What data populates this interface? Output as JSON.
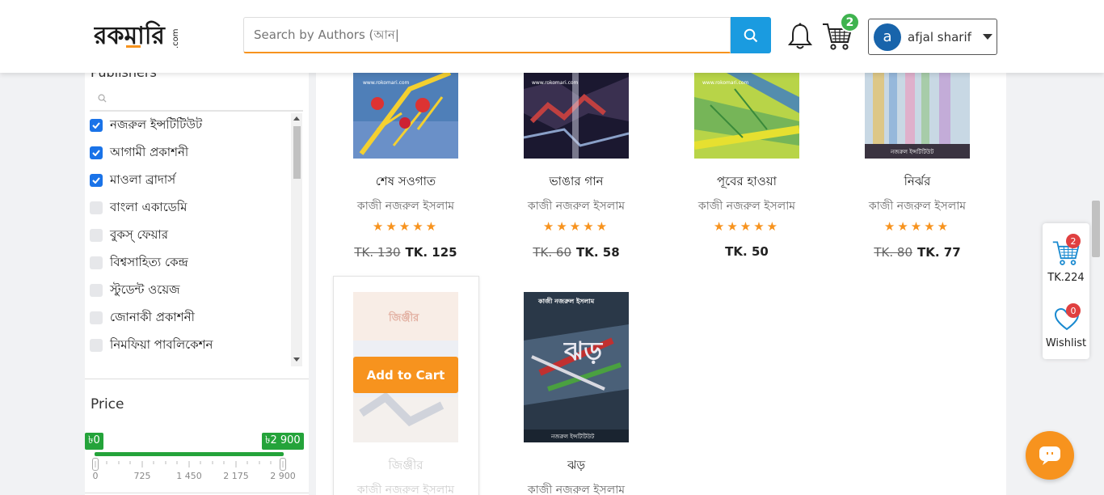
{
  "brand": {
    "logo_text": "রকমারি",
    "logo_suffix": ".com",
    "accent": "#f7931e",
    "primary": "#1a9be0"
  },
  "search": {
    "placeholder": "Search by Authors (আন|"
  },
  "header": {
    "cart_count": "2",
    "user_initial": "a",
    "user_name": "afjal sharif"
  },
  "sidebar": {
    "publishers_title": "Publishers",
    "publishers": [
      {
        "label": "নজরুল ইন্সটিটিউট",
        "checked": true
      },
      {
        "label": "আগামী প্রকাশনী",
        "checked": true
      },
      {
        "label": "মাওলা ব্রাদার্স",
        "checked": true
      },
      {
        "label": "বাংলা একাডেমি",
        "checked": false
      },
      {
        "label": "বুকস্ ফেয়ার",
        "checked": false
      },
      {
        "label": "বিশ্বসাহিত্য কেন্দ্র",
        "checked": false
      },
      {
        "label": "স্টুডেন্ট ওয়েজ",
        "checked": false
      },
      {
        "label": "জোনাকী প্রকাশনী",
        "checked": false
      },
      {
        "label": "নিমফিয়া পাবলিকেশন",
        "checked": false
      }
    ],
    "price_title": "Price",
    "price_min": "৳0",
    "price_max": "৳2 900",
    "price_ticks": [
      "0",
      "725",
      "1 450",
      "2 175",
      "2 900"
    ]
  },
  "products": [
    {
      "title": "শেষ সওগাত",
      "author": "কাজী নজরুল ইসলাম",
      "old_price": "TK. 130",
      "price": "TK. 125"
    },
    {
      "title": "ভাঙার গান",
      "author": "কাজী নজরুল ইসলাম",
      "old_price": "TK. 60",
      "price": "TK. 58"
    },
    {
      "title": "পূবের হাওয়া",
      "author": "কাজী নজরুল ইসলাম",
      "old_price": "",
      "price": "TK. 50"
    },
    {
      "title": "নির্ঝর",
      "author": "কাজী নজরুল ইসলাম",
      "old_price": "TK. 80",
      "price": "TK. 77"
    },
    {
      "title": "জিঞ্জীর",
      "author": "কাজী নজরুল ইসলাম",
      "cover_text": "জিঞ্জীর"
    },
    {
      "title": "ঝড়",
      "author": "কাজী নজরুল ইসলাম",
      "cover_text": "ঝড়",
      "cover_author": "কাজী নজরুল ইসলাম",
      "cover_publisher": "নজরুল ইন্সটিটিউট"
    }
  ],
  "cover_watermark": "www.rokomari.com",
  "cover_publisher_label": "নজরুল ইন্সটিটিউট",
  "stars": "★★★★★",
  "add_to_cart": "Add to Cart",
  "float": {
    "cart_count": "2",
    "cart_total": "TK.224",
    "wishlist_count": "0",
    "wishlist_label": "Wishlist"
  }
}
